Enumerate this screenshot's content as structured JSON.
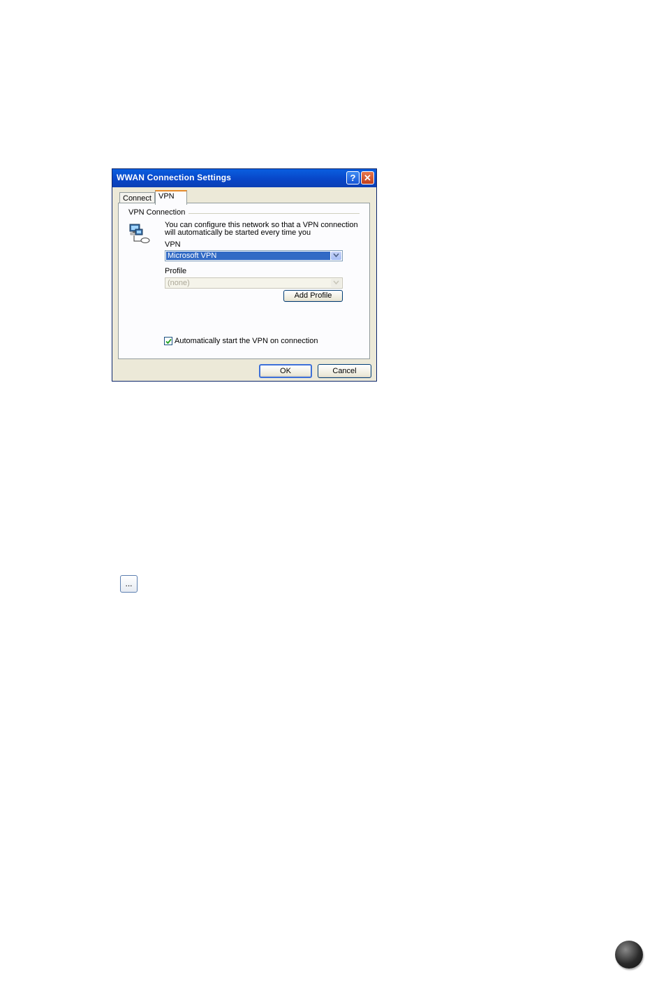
{
  "dialog": {
    "title": "WWAN Connection Settings",
    "help_glyph": "?",
    "close_glyph": "✕",
    "tabs": [
      {
        "label": "Connect",
        "active": false
      },
      {
        "label": "VPN",
        "active": true
      }
    ],
    "group_label": "VPN Connection",
    "description": "You can configure this network so that a VPN connection will automatically be started every time you",
    "vpn_label": "VPN",
    "vpn_value": "Microsoft VPN",
    "profile_label": "Profile",
    "profile_value": "(none)",
    "add_profile_label": "Add Profile",
    "auto_start_label": "Automatically start the VPN on connection",
    "auto_start_checked": true,
    "ok_label": "OK",
    "cancel_label": "Cancel"
  },
  "ellipsis_button": {
    "label": "..."
  },
  "colors": {
    "titlebar": "#0846c8",
    "selection": "#316ac5",
    "dialog_bg": "#ece9d8",
    "tab_accent": "#e68b2c"
  }
}
